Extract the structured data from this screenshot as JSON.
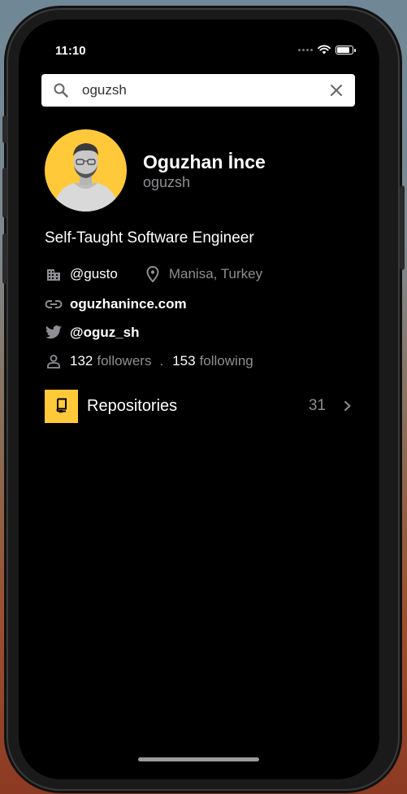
{
  "status_bar": {
    "time": "11:10"
  },
  "search": {
    "value": "oguzsh",
    "placeholder": ""
  },
  "profile": {
    "name": "Oguzhan İnce",
    "login": "oguzsh",
    "bio": "Self-Taught Software Engineer",
    "company": "@gusto",
    "location": "Manisa, Turkey",
    "website": "oguzhanince.com",
    "twitter": "@oguz_sh",
    "followers_count": "132",
    "followers_label": "followers",
    "separator": ".",
    "following_count": "153",
    "following_label": "following"
  },
  "repositories": {
    "label": "Repositories",
    "count": "31"
  },
  "colors": {
    "accent": "#ffc93a",
    "muted": "#8e8e93",
    "background": "#000000"
  }
}
